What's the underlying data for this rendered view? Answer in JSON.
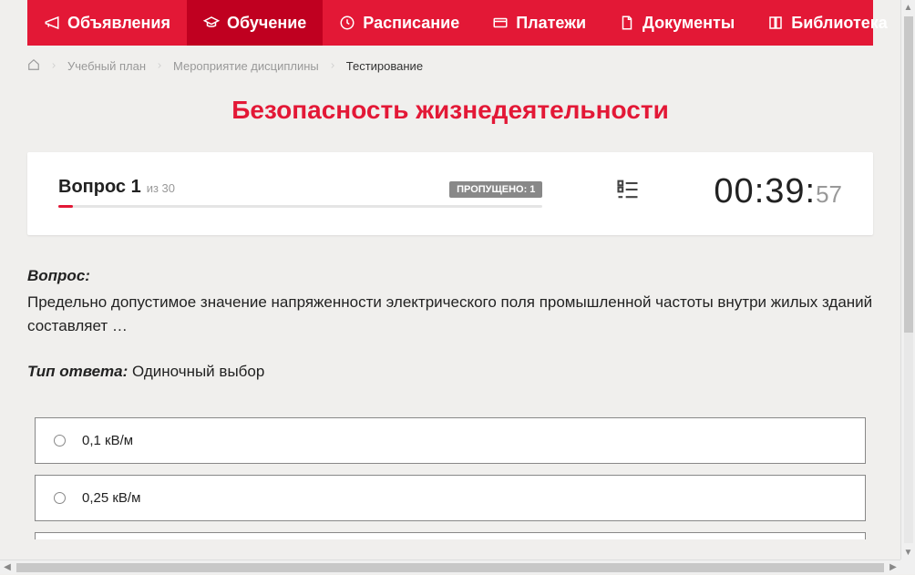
{
  "nav": {
    "items": [
      {
        "label": "Объявления",
        "icon": "megaphone"
      },
      {
        "label": "Обучение",
        "icon": "graduation",
        "active": true
      },
      {
        "label": "Расписание",
        "icon": "clock"
      },
      {
        "label": "Платежи",
        "icon": "card"
      },
      {
        "label": "Документы",
        "icon": "file"
      },
      {
        "label": "Библиотека",
        "icon": "book",
        "dropdown": true
      }
    ]
  },
  "breadcrumb": {
    "items": [
      {
        "label": "Учебный план"
      },
      {
        "label": "Мероприятие дисциплины"
      },
      {
        "label": "Тестирование",
        "current": true
      }
    ]
  },
  "page_title": "Безопасность жизнедеятельности",
  "question_panel": {
    "question_label": "Вопрос 1",
    "total_label": "из 30",
    "skipped_badge": "ПРОПУЩЕНО: 1",
    "timer_main": "00:39:",
    "timer_seconds": "57"
  },
  "question": {
    "label": "Вопрос:",
    "text": "Предельно допустимое значение напряженности электрического поля промышленной частоты внутри жилых зданий составляет …"
  },
  "answer_type": {
    "label": "Тип ответа:",
    "value": " Одиночный выбор"
  },
  "answers": [
    {
      "text": "0,1 кВ/м"
    },
    {
      "text": "0,25 кВ/м"
    }
  ]
}
